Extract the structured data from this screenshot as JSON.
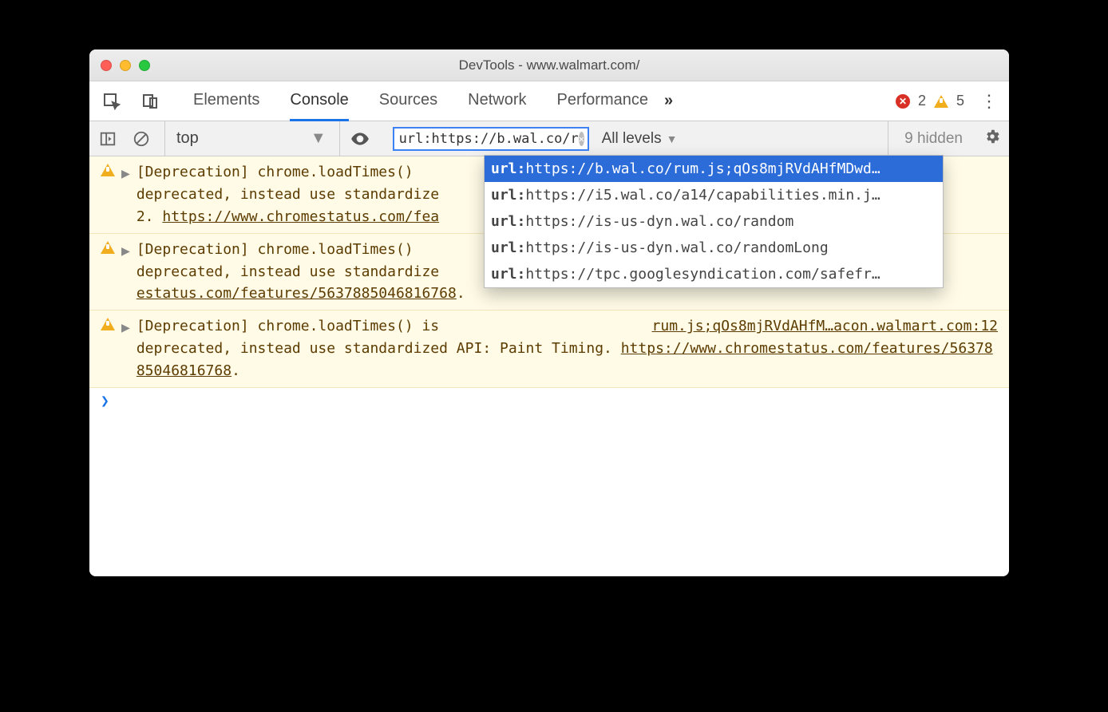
{
  "window": {
    "title": "DevTools - www.walmart.com/"
  },
  "tabs": {
    "items": [
      "Elements",
      "Console",
      "Sources",
      "Network",
      "Performance"
    ],
    "active": "Console",
    "overflow_glyph": "»",
    "error_count": "2",
    "warning_count": "5"
  },
  "filterbar": {
    "context": "top",
    "dropdown_glyph": "▼",
    "filter_value": "url:https://b.wal.co/r",
    "levels": "All levels",
    "hidden": "9 hidden"
  },
  "autocomplete": {
    "prefix": "url:",
    "items": [
      "https://b.wal.co/rum.js;qOs8mjRVdAHfMDwd…",
      "https://i5.wal.co/a14/capabilities.min.j…",
      "https://is-us-dyn.wal.co/random",
      "https://is-us-dyn.wal.co/randomLong",
      "https://tpc.googlesyndication.com/safefr…"
    ],
    "selected": 0
  },
  "messages": [
    {
      "text_a": "[Deprecation] chrome.loadTimes() ",
      "text_b": "deprecated, instead use standardize",
      "link": "https://www.chromestatus.com/fea",
      "line2_prefix": "2.  ",
      "source": ""
    },
    {
      "text_a": "[Deprecation] chrome.loadTimes() ",
      "text_b": "deprecated, instead use standardize",
      "link": "estatus.com/features/5637885046816768",
      "source": ""
    },
    {
      "text_a": "[Deprecation] chrome.loadTimes() is ",
      "text_b": "deprecated, instead use standardized API: Paint Timing. ",
      "link": "https://www.chromestatus.com/features/5637885046816768",
      "source": "rum.js;qOs8mjRVdAHfM…acon.walmart.com:12"
    }
  ],
  "prompt": "❯"
}
